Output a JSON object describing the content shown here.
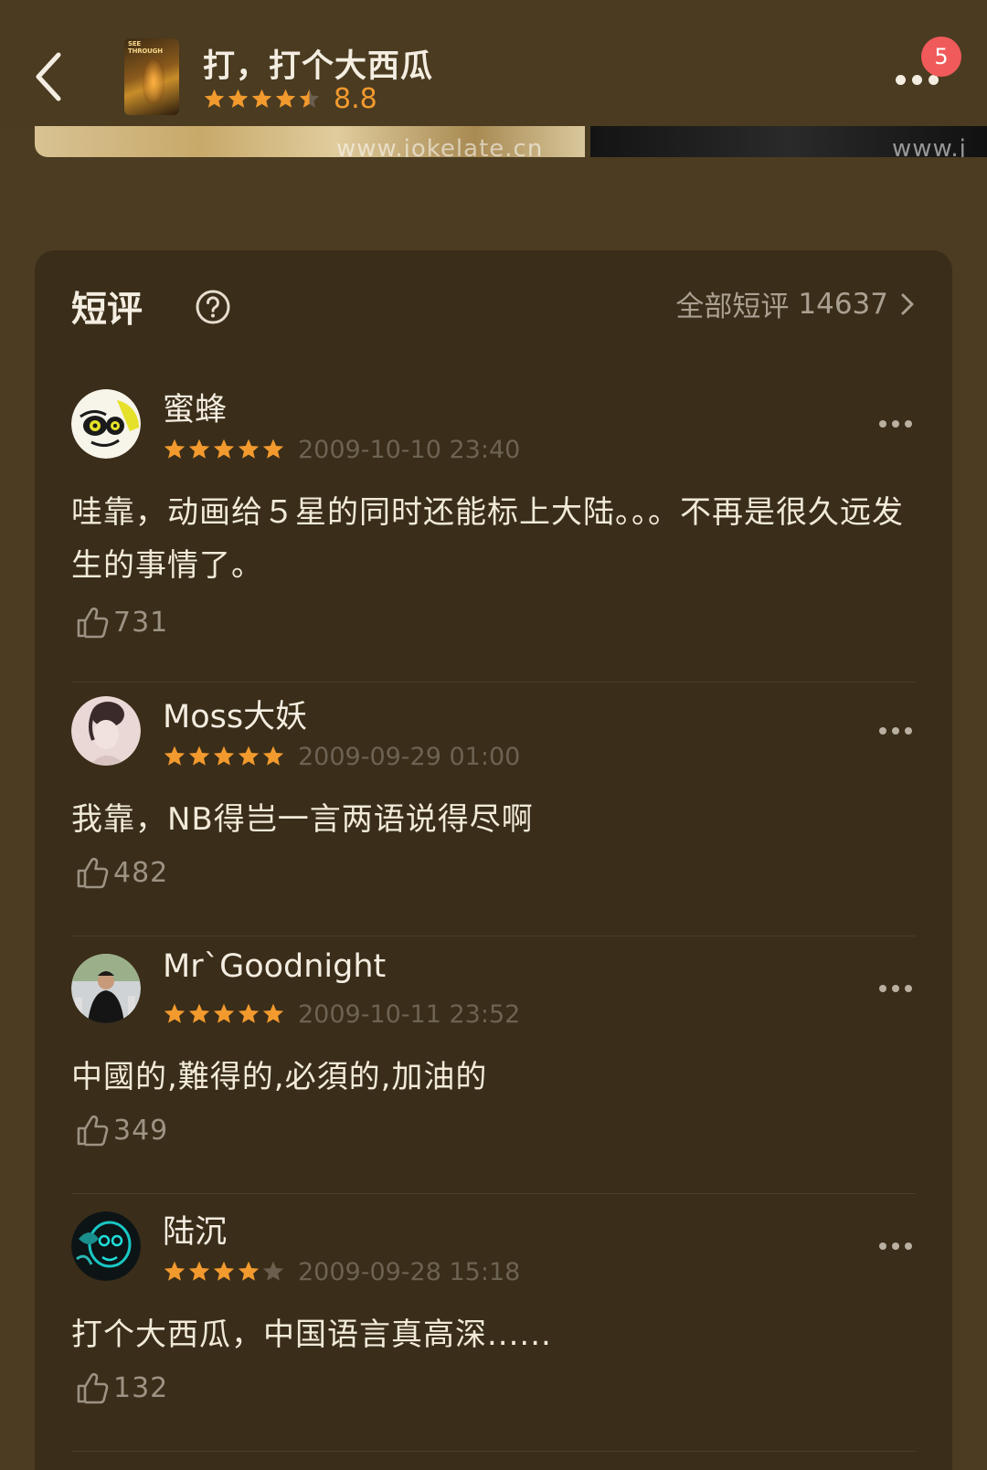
{
  "header": {
    "title": "打，打个大西瓜",
    "score": "8.8",
    "rating_stars": 4.5,
    "poster_text": "SEE THROUGH",
    "notification_count": "5"
  },
  "stills": {
    "watermark_1": "www.jokelate.cn",
    "watermark_2": "www.j"
  },
  "short_reviews": {
    "title": "短评",
    "all_label": "全部短评",
    "total": "14637"
  },
  "reviews": [
    {
      "username": "蜜蜂",
      "stars": 5,
      "time": "2009-10-10 23:40",
      "content": "哇靠，动画给５星的同时还能标上大陆。。。不再是很久远发生的事情了。",
      "likes": "731"
    },
    {
      "username": "Moss大妖",
      "stars": 5,
      "time": "2009-09-29 01:00",
      "content": "我靠，NB得岂一言两语说得尽啊",
      "likes": "482"
    },
    {
      "username": "Mr`Goodnight",
      "stars": 5,
      "time": "2009-10-11 23:52",
      "content": "中國的,難得的,必須的,加油的",
      "likes": "349"
    },
    {
      "username": "陆沉",
      "stars": 4,
      "time": "2009-09-28 15:18",
      "content": "打个大西瓜，中国语言真高深......",
      "likes": "132"
    }
  ],
  "colors": {
    "background": "#4b3c22",
    "card": "#3a2d19",
    "accent_star": "#f29a2e",
    "badge": "#f05a5a"
  }
}
